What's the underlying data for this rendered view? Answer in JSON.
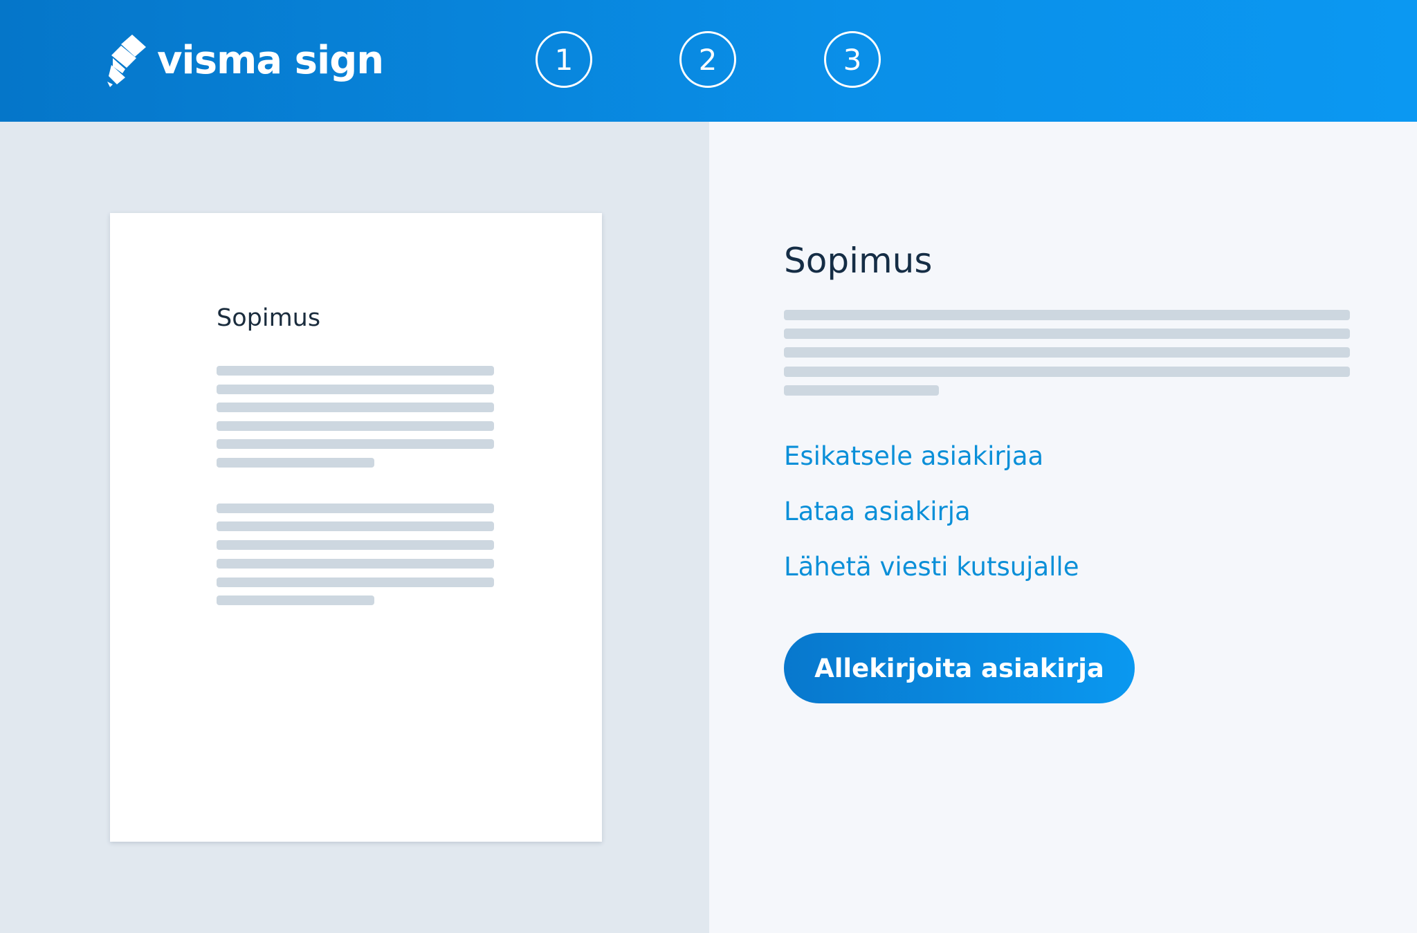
{
  "header": {
    "logo_text": "visma sign",
    "steps": [
      {
        "label": "1"
      },
      {
        "label": "2"
      },
      {
        "label": "3"
      }
    ]
  },
  "preview": {
    "doc_title": "Sopimus"
  },
  "details": {
    "title": "Sopimus",
    "links": [
      {
        "label": "Esikatsele asiakirjaa"
      },
      {
        "label": "Lataa asiakirja"
      },
      {
        "label": "Lähetä viesti kutsujalle"
      }
    ],
    "sign_button": "Allekirjoita asiakirja"
  },
  "colors": {
    "header_start": "#0576c9",
    "header_end": "#0b98f2",
    "link": "#0a8fd8",
    "placeholder_line": "#cdd7e0",
    "left_bg": "#e1e8ef",
    "right_bg": "#f5f7fb"
  }
}
